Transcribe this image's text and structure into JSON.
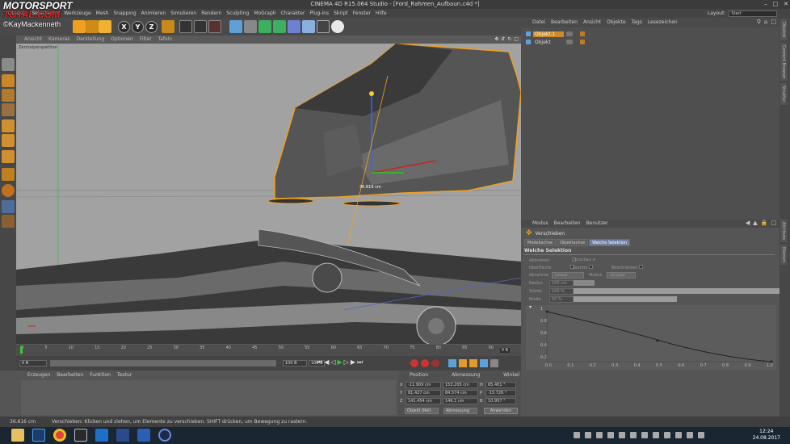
{
  "watermark": {
    "brand_line1": "MOTORSPORT",
    "brand_line2": "TOTAL.COM",
    "credit": "©KayMackenneth"
  },
  "title": "CINEMA 4D R15.064 Studio - [Ford_Rahmen_Aufbaun.c4d *]",
  "menu": [
    "Objekte",
    "Selektieren",
    "Werkzeuge",
    "Mesh",
    "Snapping",
    "Animieren",
    "Simulieren",
    "Rendern",
    "Sculpting",
    "MoGraph",
    "Charakter",
    "Plug-ins",
    "Skript",
    "Fenster",
    "Hilfe"
  ],
  "layout": {
    "label": "Layout:",
    "value": "Start"
  },
  "axis_buttons": [
    "X",
    "Y",
    "Z"
  ],
  "view_menu": [
    "Ansicht",
    "Kameras",
    "Darstellung",
    "Optionen",
    "Filter",
    "Tafeln"
  ],
  "viewport": {
    "label": "Zentralperspektive",
    "measure": "36.616 cm"
  },
  "timeline": {
    "ticks": [
      "0",
      "5",
      "10",
      "15",
      "20",
      "25",
      "30",
      "35",
      "40",
      "45",
      "50",
      "55",
      "60",
      "65",
      "70",
      "75",
      "80",
      "85",
      "90"
    ],
    "end_marker": "0 B"
  },
  "playbar": {
    "frame_start": "0 B",
    "frame_end": "100 B",
    "frame_max": "100 B"
  },
  "object_manager": {
    "menu": [
      "Datei",
      "Bearbeiten",
      "Ansicht",
      "Objekte",
      "Tags",
      "Lesezeichen"
    ],
    "objects": [
      {
        "name": "Objekt.1",
        "selected": true
      },
      {
        "name": "Objekt",
        "selected": false
      }
    ]
  },
  "attribute_manager": {
    "menu": [
      "Modus",
      "Bearbeiten",
      "Benutzer"
    ],
    "tool_name": "Verschieben",
    "tabs": [
      "Modellachse",
      "Objektachse",
      "Weiche Selektion"
    ],
    "active_tab": "Weiche Selektion",
    "section": "Weiche Selektion",
    "checkboxes": [
      {
        "label": "Aktivieren",
        "checked": false
      },
      {
        "label": "Vorschau",
        "checked": true
      },
      {
        "label": "Oberfläche",
        "checked": false
      },
      {
        "label": "Gummi",
        "checked": false
      },
      {
        "label": "Beschränken",
        "checked": false
      }
    ],
    "falloff": {
      "label": "Abnahme",
      "value": "Linear",
      "mode_label": "Modus",
      "mode_value": "Gruppe"
    },
    "radius": {
      "label": "Radius",
      "value": "100 cm",
      "fill": 0.1
    },
    "strength": {
      "label": "Stärke",
      "value": "100 %",
      "fill": 1.0
    },
    "width": {
      "label": "Breite",
      "value": "50 %",
      "fill": 0.5
    },
    "graph": {
      "y_ticks": [
        "1",
        "0.8",
        "0.6",
        "0.4",
        "0.2"
      ],
      "x_ticks": [
        "0.0",
        "0.1",
        "0.2",
        "0.3",
        "0.4",
        "0.5",
        "0.6",
        "0.7",
        "0.8",
        "0.9",
        "1.0"
      ]
    }
  },
  "right_dock_tabs": [
    "Objekte",
    "Content Browser",
    "Struktur"
  ],
  "right_dock_tabs_lower": [
    "Attribute",
    "Ebenen"
  ],
  "material_manager": {
    "menu": [
      "Erzeugen",
      "Bearbeiten",
      "Funktion",
      "Textur"
    ]
  },
  "coordinates": {
    "headers": [
      "Position",
      "Abmessung",
      "Winkel"
    ],
    "rows": [
      {
        "axis": "X",
        "pos": "-11.909 cm",
        "size": "153.205 cm",
        "rot_label": "H",
        "rot": "65.401 °"
      },
      {
        "axis": "Y",
        "pos": "81.427 cm",
        "size": "84.574 cm",
        "rot_label": "P",
        "rot": "-15.726 °"
      },
      {
        "axis": "Z",
        "pos": "141.454 cm",
        "size": "146.1 cm",
        "rot_label": "B",
        "rot": "10.957 °"
      }
    ],
    "mode1": "Objekt (Rel)",
    "mode2": "Abmessung",
    "apply": "Anwenden"
  },
  "status": {
    "value": "36.616 cm",
    "message": "Verschieben: Klicken und ziehen, um Elemente zu verschieben. SHIFT drücken, um Bewegung zu rastern."
  },
  "taskbar": {
    "time": "12:24",
    "date": "24.08.2017"
  },
  "colors": {
    "accent_orange": "#f0a020",
    "selection_blue": "#6f7fa0",
    "viewport_bg": "#a2a2a2"
  }
}
